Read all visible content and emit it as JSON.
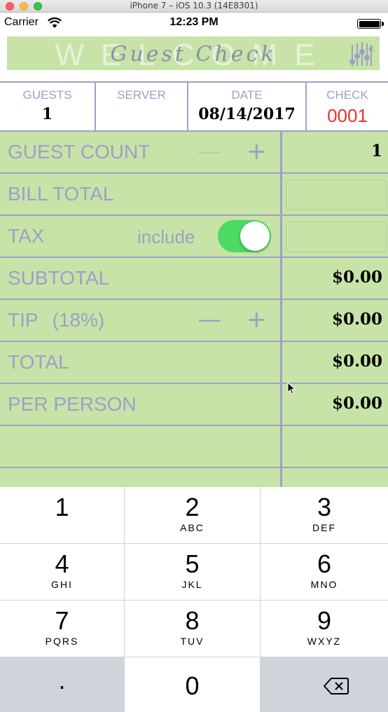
{
  "window": {
    "title": "iPhone 7 – iOS 10.3 (14E8301)"
  },
  "status_bar": {
    "carrier": "Carrier",
    "time": "12:23 PM"
  },
  "banner": {
    "background_word": "WELCOME",
    "logo": "Guest Check",
    "settings_icon": "sliders-icon"
  },
  "header": {
    "guests_label": "GUESTS",
    "guests_value": "1",
    "server_label": "SERVER",
    "server_value": "",
    "date_label": "DATE",
    "date_value": "08/14/2017",
    "check_label": "CHECK",
    "check_value": "0001"
  },
  "rows": {
    "guest_count": {
      "label": "GUEST COUNT",
      "minus": "—",
      "plus": "+",
      "value": "1"
    },
    "bill_total": {
      "label": "BILL TOTAL",
      "value": ""
    },
    "tax": {
      "label": "TAX",
      "include_label": "include",
      "include_on": true,
      "value": ""
    },
    "subtotal": {
      "label": "SUBTOTAL",
      "value": "$0.00"
    },
    "tip": {
      "label": "TIP",
      "percent": "(18%)",
      "minus": "—",
      "plus": "+",
      "value": "$0.00"
    },
    "total": {
      "label": "TOTAL",
      "value": "$0.00"
    },
    "per_person": {
      "label": "PER PERSON",
      "value": "$0.00"
    }
  },
  "keypad": {
    "keys": [
      {
        "num": "1",
        "letters": ""
      },
      {
        "num": "2",
        "letters": "ABC"
      },
      {
        "num": "3",
        "letters": "DEF"
      },
      {
        "num": "4",
        "letters": "GHI"
      },
      {
        "num": "5",
        "letters": "JKL"
      },
      {
        "num": "6",
        "letters": "MNO"
      },
      {
        "num": "7",
        "letters": "PQRS"
      },
      {
        "num": "8",
        "letters": "TUV"
      },
      {
        "num": "9",
        "letters": "WXYZ"
      }
    ],
    "decimal": ".",
    "zero": "0",
    "delete_icon": "backspace-icon"
  },
  "colors": {
    "accent": "#9ea0c8",
    "table_bg": "#c7e3a7",
    "check_number": "#e5332a",
    "toggle_on": "#4cd964"
  }
}
